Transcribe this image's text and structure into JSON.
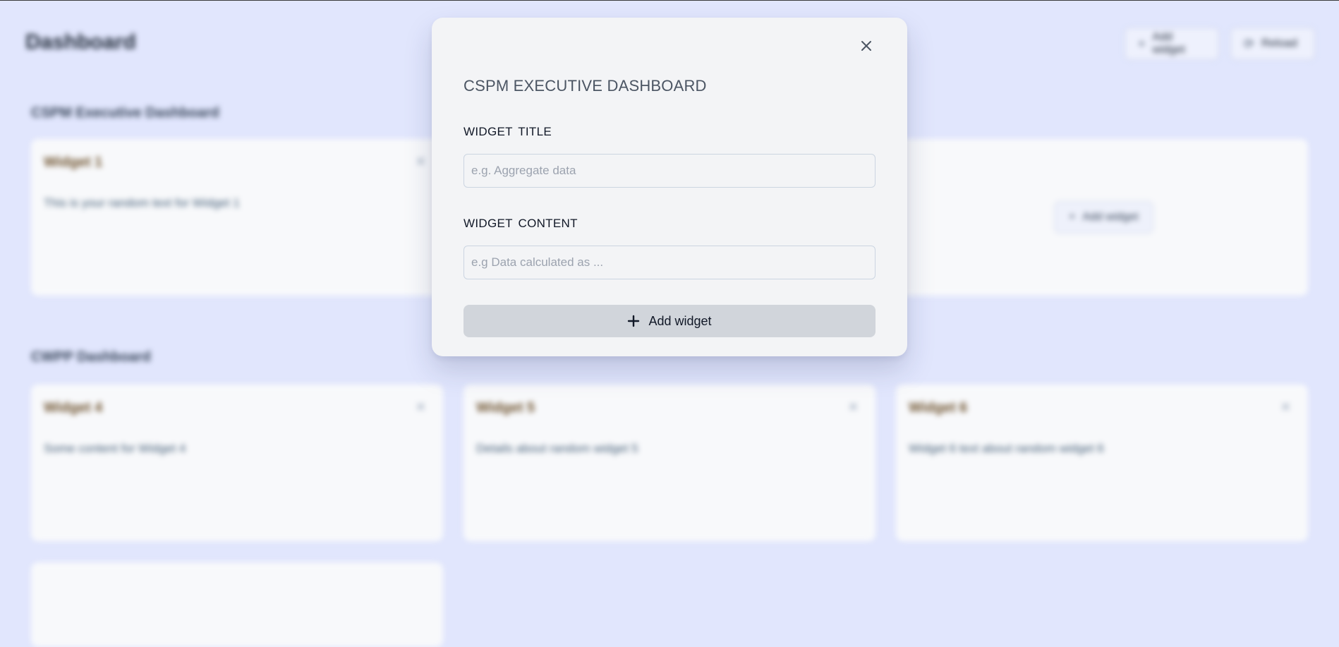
{
  "background": {
    "page_title": "Dashboard",
    "header_buttons": [
      {
        "label": "Add widget",
        "icon": "plus-icon"
      },
      {
        "label": "Reload",
        "icon": "refresh-icon"
      }
    ],
    "sections": [
      {
        "title": "CSPM Executive Dashboard",
        "cards": [
          {
            "title": "Widget 1",
            "text": "This is your random text for Widget 1"
          }
        ],
        "add_label": "Add widget"
      },
      {
        "title": "CWPP Dashboard",
        "cards": [
          {
            "title": "Widget 4",
            "text": "Some content for Widget 4"
          },
          {
            "title": "Widget 5",
            "text": "Details about random widget 5"
          },
          {
            "title": "Widget 6",
            "text": "Widget 6 text about random widget 6"
          }
        ]
      }
    ]
  },
  "modal": {
    "title": "CSPM EXECUTIVE DASHBOARD",
    "close_icon": "close-icon",
    "fields": {
      "title_label": "WIDGET  TITLE",
      "title_placeholder": "e.g. Aggregate data",
      "title_value": "",
      "content_label": "WIDGET  CONTENT",
      "content_placeholder": "e.g Data calculated as ...",
      "content_value": ""
    },
    "submit_label": "Add widget",
    "submit_icon": "plus-icon"
  },
  "colors": {
    "page_bg": "#e1e6fd",
    "modal_bg": "#f3f4f6",
    "button_bg": "#d1d5db"
  }
}
